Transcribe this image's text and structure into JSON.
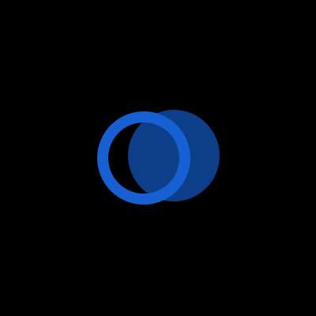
{
  "screen": {
    "background_color": "#000000"
  },
  "loader": {
    "icon": "loading-spinner-icon",
    "ring_color": "#1660D4",
    "disc_color": "#0D3E8A"
  }
}
